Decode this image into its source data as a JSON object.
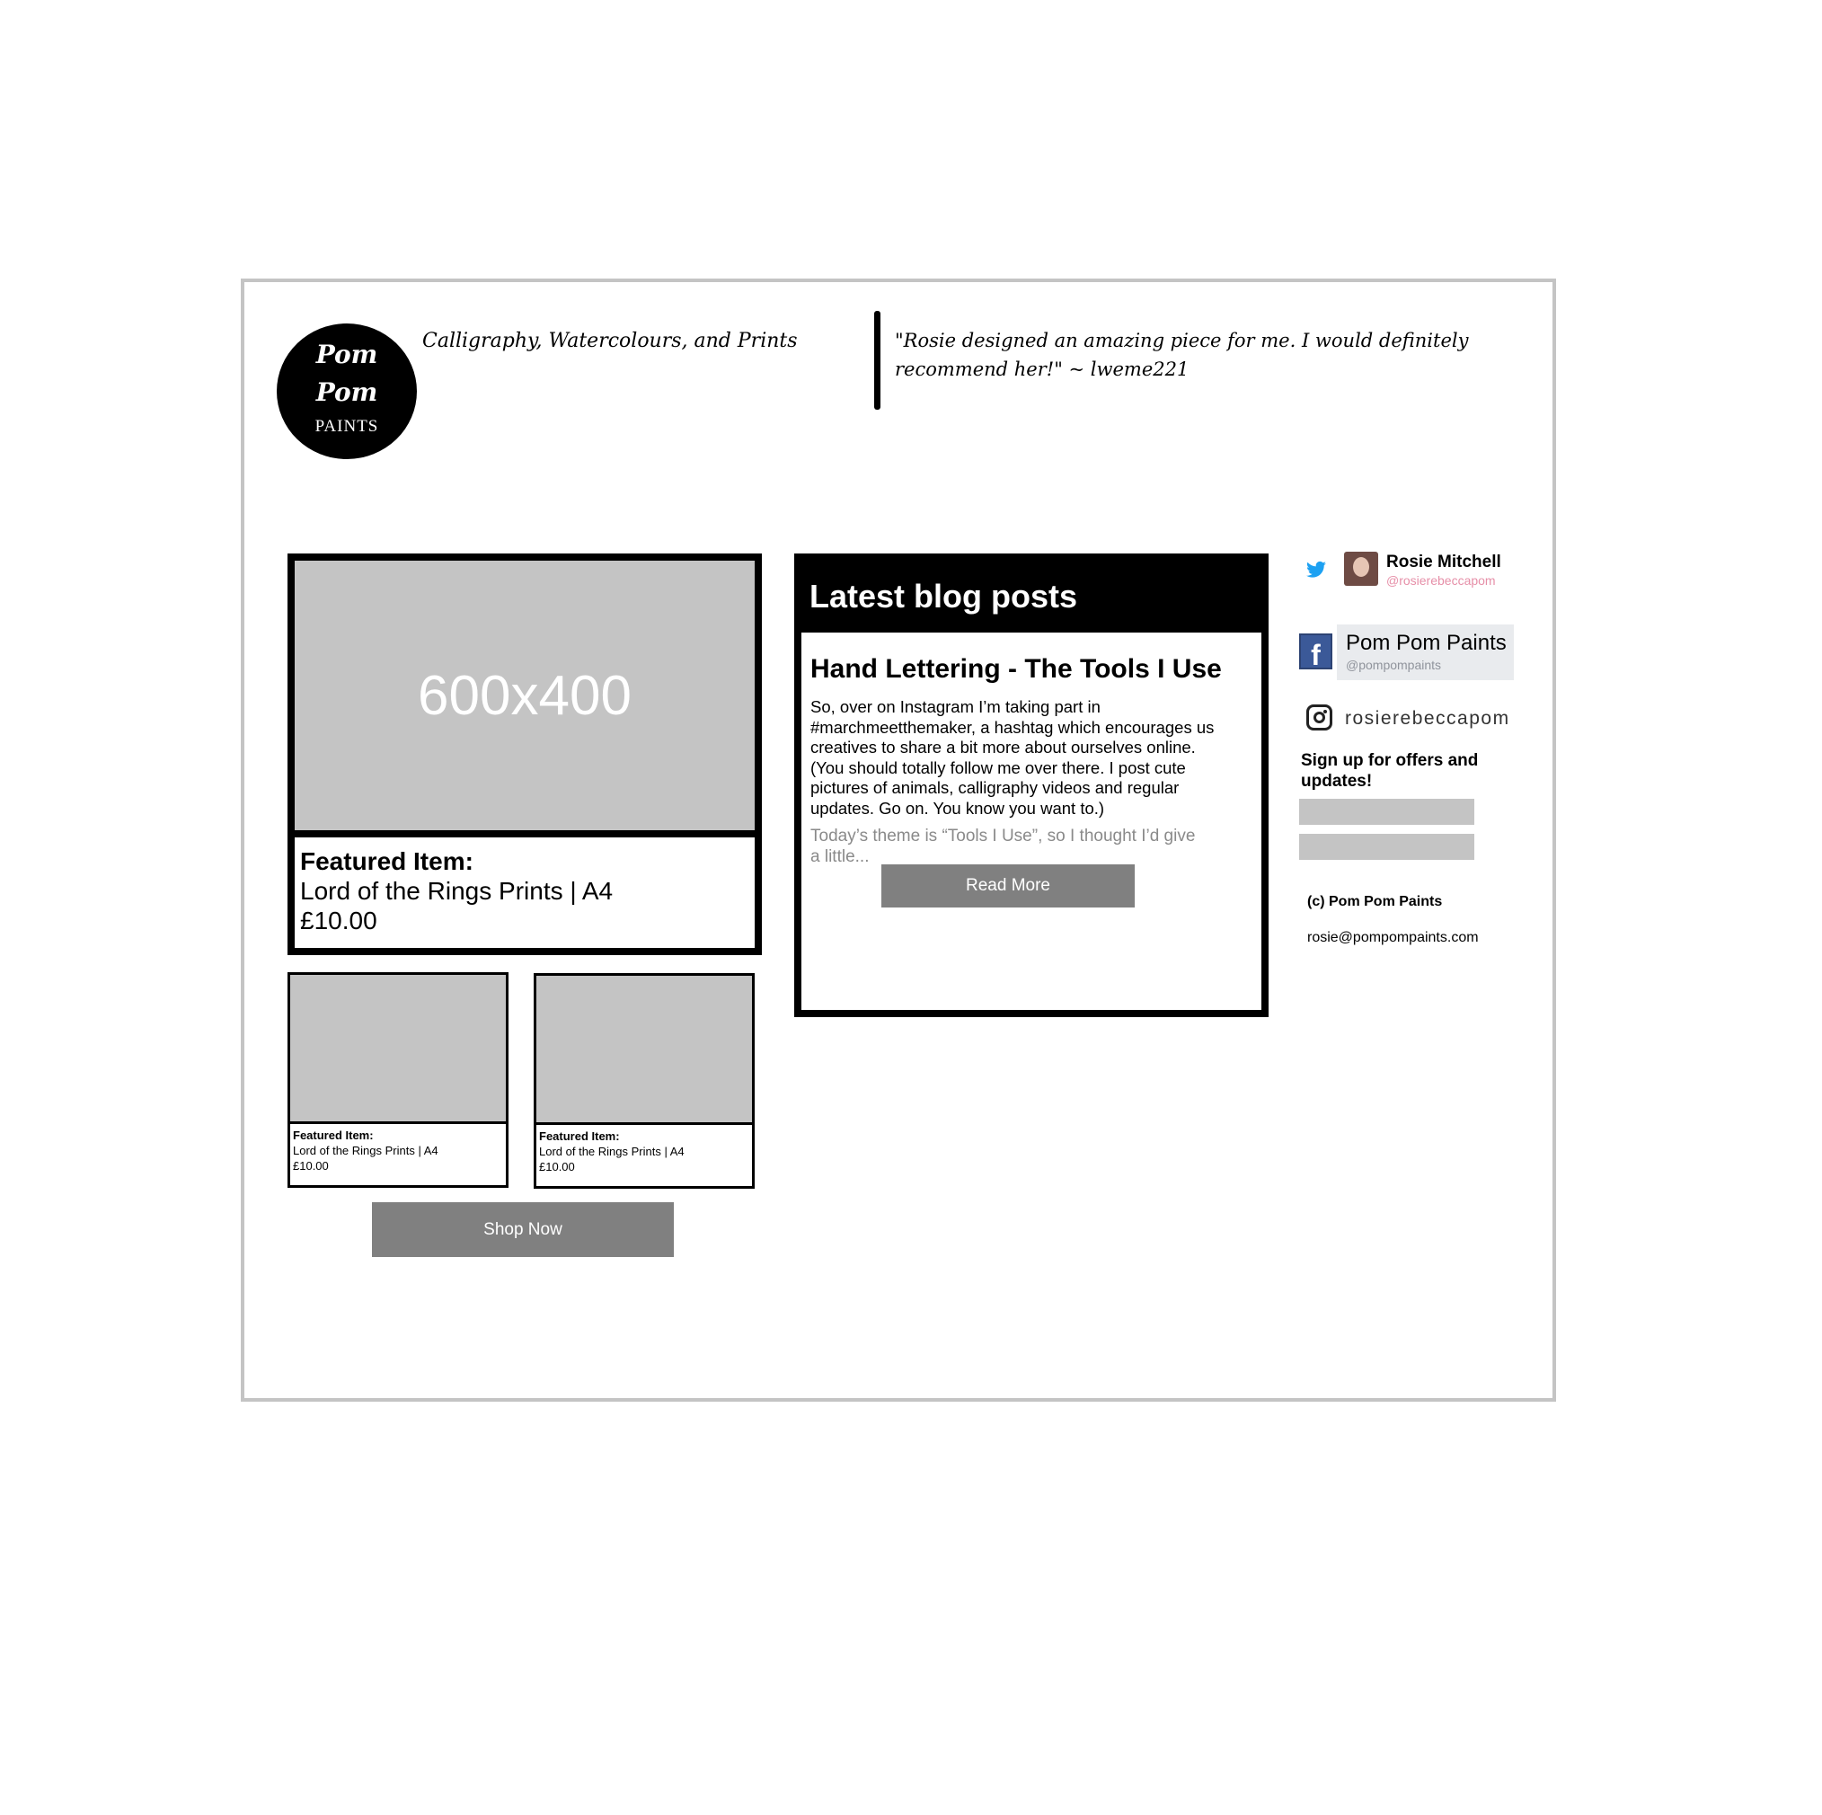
{
  "header": {
    "logo": {
      "line1": "Pom",
      "line2": "Pom",
      "line3": "PAINTS"
    },
    "tagline": "Calligraphy, Watercolours, and Prints",
    "quote": "\"Rosie designed an amazing piece for me. I would definitely recommend her!\" ~ lweme221"
  },
  "featured_main": {
    "image_placeholder": "600x400",
    "label": "Featured Item:",
    "name": "Lord of the Rings Prints | A4",
    "price": "£10.00"
  },
  "featured_small": [
    {
      "label": "Featured Item:",
      "name": "Lord of the Rings Prints | A4",
      "price": "£10.00"
    },
    {
      "label": "Featured Item:",
      "name": "Lord of the Rings Prints | A4",
      "price": "£10.00"
    }
  ],
  "shop_button": "Shop Now",
  "blog": {
    "heading": "Latest blog posts",
    "post_title": "Hand Lettering - The Tools I Use",
    "excerpt": "So, over on Instagram I’m taking part in #marchmeetthemaker, a hashtag which encourages us creatives to share a bit more about ourselves online.  (You should totally follow me over there.  I post cute pictures of animals, calligraphy videos and regular updates.  Go on.  You know you want to.)",
    "excerpt_fade": "Today’s theme is “Tools I Use”, so I thought I’d give a little...",
    "read_more": "Read More"
  },
  "sidebar": {
    "twitter": {
      "name": "Rosie Mitchell",
      "handle": "@rosierebeccapom",
      "icon": "twitter-bird-icon"
    },
    "facebook": {
      "name": "Pom Pom Paints",
      "handle": "@pompompaints",
      "icon": "facebook-icon",
      "icon_glyph": "f"
    },
    "instagram": {
      "name": "rosierebeccapom",
      "icon": "instagram-icon"
    },
    "signup_heading": "Sign up for offers and updates!",
    "copyright": "(c) Pom Pom Paints",
    "email": "rosie@pompompaints.com"
  },
  "colors": {
    "placeholder_gray": "#c4c4c4",
    "button_gray": "#808080",
    "frame_border": "#c4c4c4",
    "twitter_blue": "#1da1f2",
    "facebook_blue": "#3b5998",
    "twitter_handle_pink": "#e68fa8"
  }
}
